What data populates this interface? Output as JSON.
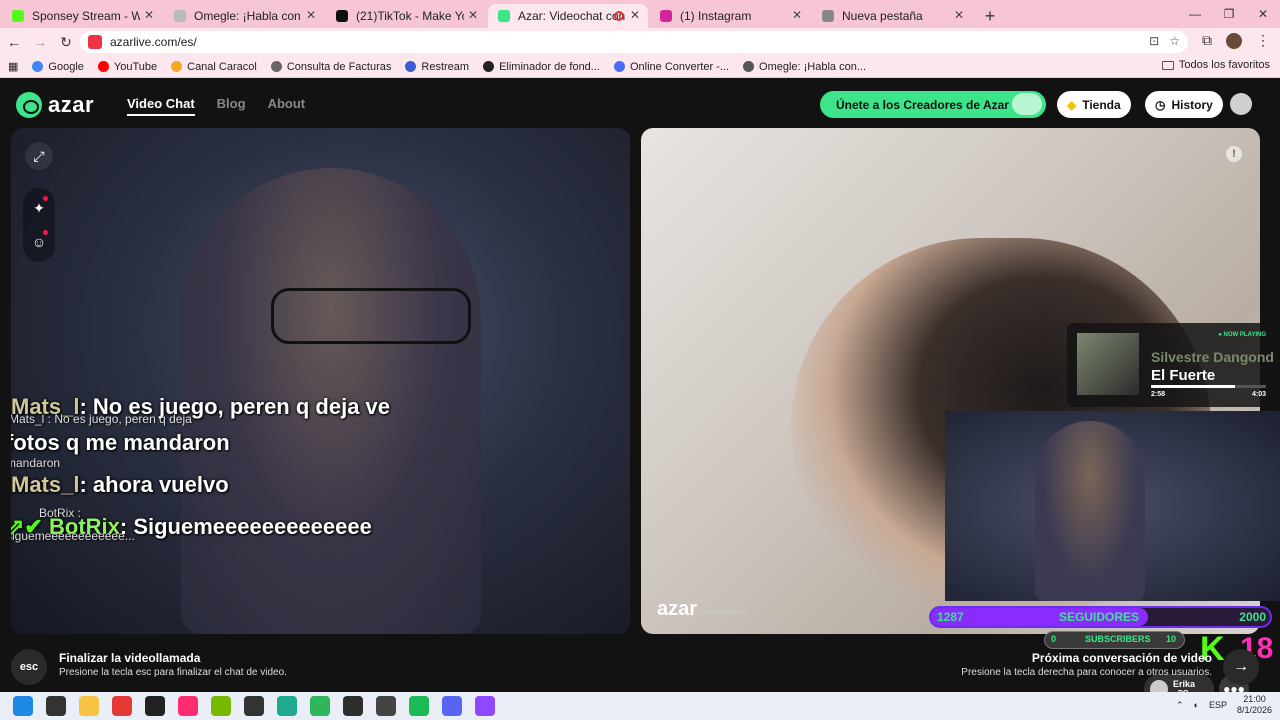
{
  "browser": {
    "tabs": [
      {
        "label": "Sponsey Stream - Watch Live o",
        "fav_color": "#53fc18"
      },
      {
        "label": "Omegle: ¡Habla con Desconoci",
        "fav_color": "#bbbbbb"
      },
      {
        "label": "(21)TikTok - Make Your Day",
        "fav_color": "#111111"
      },
      {
        "label": "Azar: Videochat con gente",
        "fav_color": "#3de58a"
      },
      {
        "label": "(1) Instagram",
        "fav_color": "#d6249f"
      },
      {
        "label": "Nueva pestaña",
        "fav_color": "#888888"
      }
    ],
    "active_tab_index": 3,
    "url": "azarlive.com/es/",
    "new_tab": "+",
    "window": {
      "minimize": "—",
      "restore": "❐",
      "close": "✕"
    },
    "bookmarks": [
      {
        "label": "Google",
        "color": "#4285f4"
      },
      {
        "label": "YouTube",
        "color": "#ff0000"
      },
      {
        "label": "Canal Caracol",
        "color": "#f5a623"
      },
      {
        "label": "Consulta de Facturas",
        "color": "#666666"
      },
      {
        "label": "Restream",
        "color": "#3b5bdb"
      },
      {
        "label": "Eliminador de fond...",
        "color": "#222222"
      },
      {
        "label": "Online Converter -...",
        "color": "#4a6cf7"
      },
      {
        "label": "Omegle: ¡Habla con...",
        "color": "#555555"
      }
    ],
    "all_favorites": "Todos los favoritos"
  },
  "site": {
    "logo": "azar",
    "nav": [
      {
        "label": "Video Chat",
        "active": true
      },
      {
        "label": "Blog",
        "active": false
      },
      {
        "label": "About",
        "active": false
      }
    ],
    "creators_button": "Únete a los Creadores de Azar",
    "store_button": "Tienda",
    "history_button": "History"
  },
  "left_video": {
    "chat": [
      {
        "user": "Mats_l",
        "text": ": No es juego, peren q deja ve"
      },
      {
        "user": "",
        "text": "fotos q me mandaron"
      },
      {
        "user": "Mats_l",
        "text": ": ahora vuelvo"
      },
      {
        "user": "BotRix",
        "text": ": Siguemeeeeeeeeeeeee"
      }
    ],
    "ghost_chat": [
      "Mats_l : No es juego, peren q deja",
      "mandaron",
      "BotRix :",
      "siguemeeeeeeeeeeee..."
    ]
  },
  "right_video": {
    "watermark": "azar",
    "watermark_id": "Hkw2B8CAVX",
    "report": "!",
    "now_playing": {
      "tag": "● NOW PLAYING",
      "artist": "Silvestre Dangond",
      "title": "El Fuerte",
      "elapsed": "2:58",
      "duration": "4:03",
      "progress": 0.73
    },
    "followers": {
      "current": "1287",
      "label": "SEGUIDORES",
      "goal": "2000",
      "progress": 0.64
    },
    "subs": {
      "current": "0",
      "label": "SUBSCRIBERS",
      "goal": "10"
    },
    "kick_logo": "K",
    "age": "18",
    "peer": {
      "name": "Erika",
      "country": "DO"
    }
  },
  "footer": {
    "esc_key": "esc",
    "end_title": "Finalizar la videollamada",
    "end_sub": "Presione la tecla esc para finalizar el chat de video.",
    "next_title": "Próxima conversación de video",
    "next_sub": "Presione la tecla derecha para conocer a otros usuarios.",
    "next_icon": "→"
  },
  "taskbar": {
    "lang": "ESP",
    "time": "21:00",
    "date": "8/1/2026",
    "apps": [
      {
        "name": "start-icon",
        "color": "#1e88e5"
      },
      {
        "name": "search-icon",
        "color": "#333333"
      },
      {
        "name": "file-explorer-icon",
        "color": "#f6c343"
      },
      {
        "name": "chrome-icon",
        "color": "#e53935"
      },
      {
        "name": "call-of-duty-icon",
        "color": "#222222"
      },
      {
        "name": "tiktok-icon",
        "color": "#ff2d6f"
      },
      {
        "name": "nvidia-icon",
        "color": "#76b900"
      },
      {
        "name": "tf-icon",
        "color": "#333333"
      },
      {
        "name": "edge-icon",
        "color": "#1faa8f"
      },
      {
        "name": "photos-icon",
        "color": "#2fb65a"
      },
      {
        "name": "terminal-icon",
        "color": "#2d2d2d"
      },
      {
        "name": "obs-icon",
        "color": "#444444"
      },
      {
        "name": "spotify-icon",
        "color": "#1db954"
      },
      {
        "name": "discord-icon",
        "color": "#5865f2"
      },
      {
        "name": "twitch-icon",
        "color": "#9146ff"
      }
    ]
  }
}
